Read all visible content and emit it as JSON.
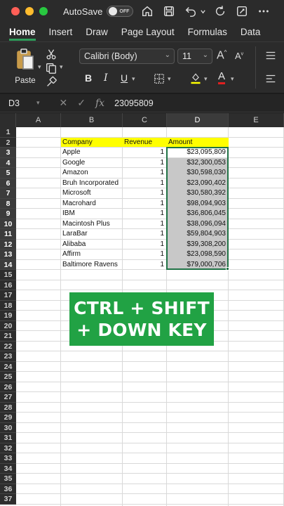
{
  "titlebar": {
    "autosave_label": "AutoSave",
    "autosave_state": "OFF",
    "icons": [
      "home-icon",
      "save-icon",
      "undo-icon",
      "redo-icon",
      "more-icon"
    ]
  },
  "tabs": [
    "Home",
    "Insert",
    "Draw",
    "Page Layout",
    "Formulas",
    "Data"
  ],
  "ribbon": {
    "paste_label": "Paste",
    "font_name": "Calibri (Body)",
    "font_size": "11",
    "bold": "B",
    "italic": "I",
    "underline": "U",
    "grow_font": "A",
    "shrink_font": "A",
    "font_color_letter": "A"
  },
  "formula_bar": {
    "cell_ref": "D3",
    "value": "23095809"
  },
  "columns": [
    "A",
    "B",
    "C",
    "D",
    "E"
  ],
  "rows": [
    "1",
    "2",
    "3",
    "4",
    "5",
    "6",
    "7",
    "8",
    "9",
    "10",
    "11",
    "12",
    "13",
    "14",
    "15",
    "16",
    "17",
    "18",
    "19",
    "20",
    "21",
    "22",
    "23",
    "24",
    "25",
    "26",
    "27",
    "28",
    "29",
    "30",
    "31",
    "32",
    "33",
    "34",
    "35",
    "36",
    "37"
  ],
  "table": {
    "headers": [
      "Company",
      "Revenue",
      "Amount"
    ],
    "records": [
      [
        "Apple",
        "1",
        "$23,095,809"
      ],
      [
        "Google",
        "1",
        "$32,300,053"
      ],
      [
        "Amazon",
        "1",
        "$30,598,030"
      ],
      [
        "Bruh Incorporated",
        "1",
        "$23,090,402"
      ],
      [
        "Microsoft",
        "1",
        "$30,580,392"
      ],
      [
        "Macrohard",
        "1",
        "$98,094,903"
      ],
      [
        "IBM",
        "1",
        "$36,806,045"
      ],
      [
        "Macintosh Plus",
        "1",
        "$38,096,094"
      ],
      [
        "LaraBar",
        "1",
        "$59,804,903"
      ],
      [
        "Alibaba",
        "1",
        "$39,308,200"
      ],
      [
        "Affirm",
        "1",
        "$23,098,590"
      ],
      [
        "Baltimore Ravens",
        "1",
        "$79,000,706"
      ]
    ]
  },
  "banner": {
    "line1": "CTRL + SHIFT",
    "line2": "+ DOWN KEY"
  },
  "colors": {
    "accent": "#217346",
    "header_fill": "#ffff00",
    "banner": "#21a244"
  }
}
